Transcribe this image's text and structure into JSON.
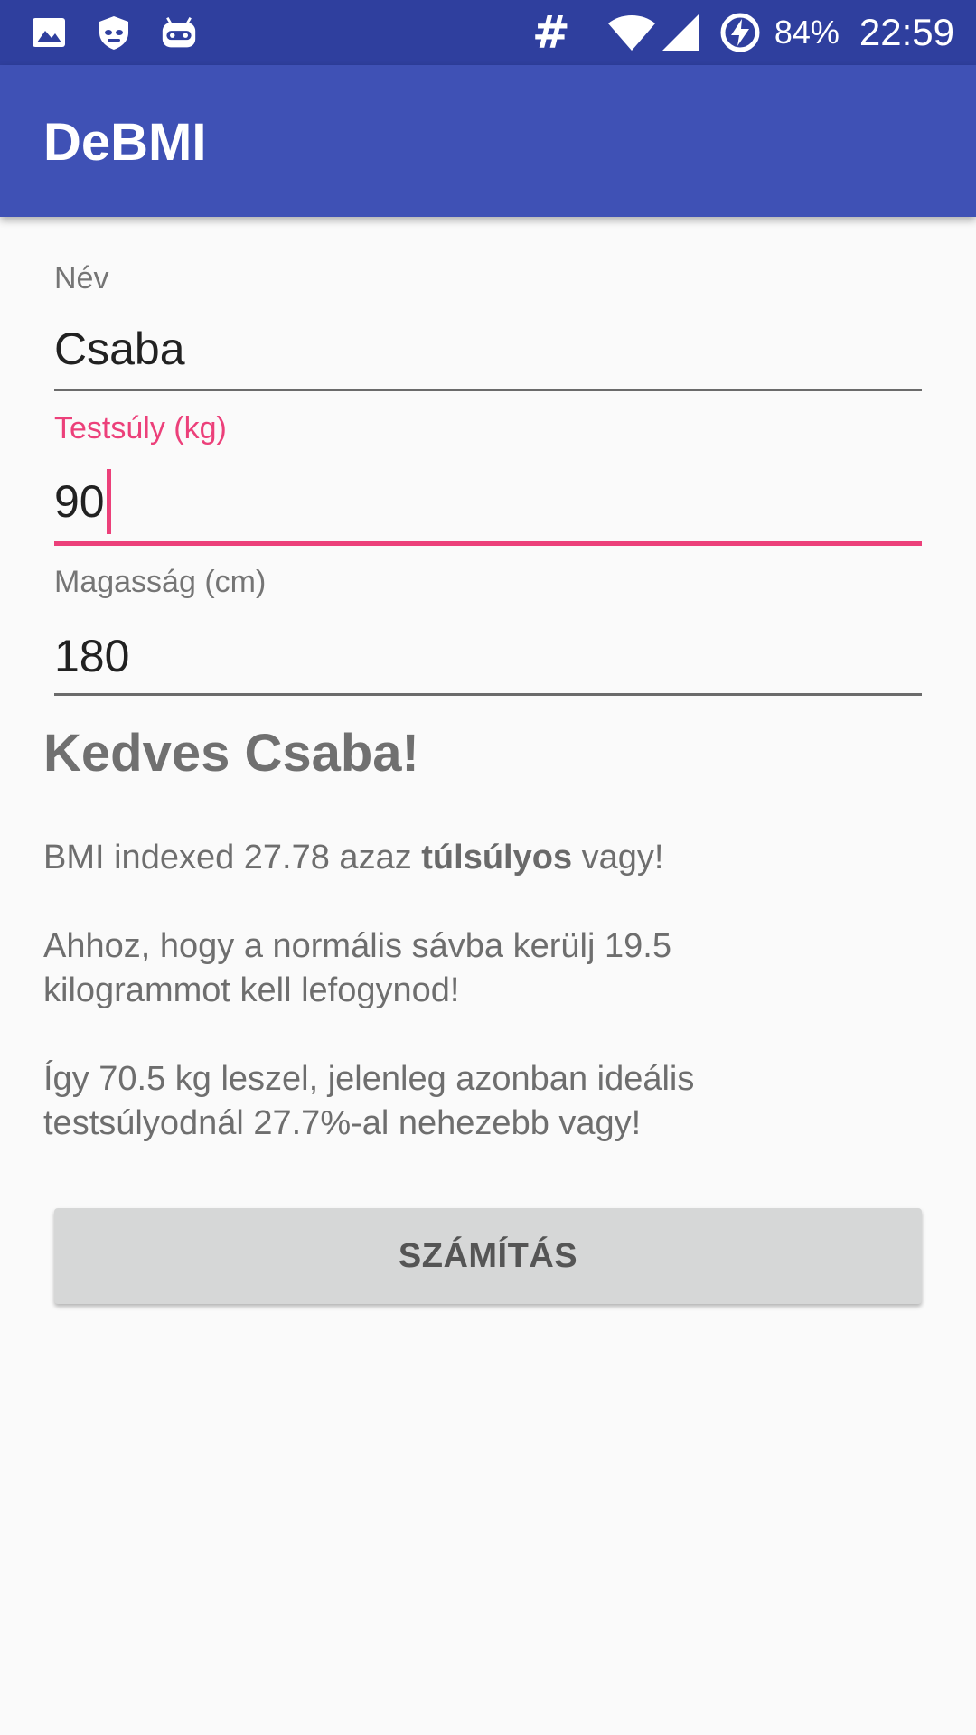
{
  "status_bar": {
    "battery": "84%",
    "time": "22:59",
    "hash_symbol": "#",
    "icons": [
      "image-icon",
      "shield-icon",
      "android-icon",
      "wifi-icon",
      "signal-icon",
      "battery-charging-icon"
    ]
  },
  "app_bar": {
    "title": "DeBMI"
  },
  "form": {
    "name": {
      "label": "Név",
      "value": "Csaba"
    },
    "weight": {
      "label": "Testsúly (kg)",
      "value": "90"
    },
    "height": {
      "label": "Magasság (cm)",
      "value": "180"
    }
  },
  "result": {
    "greeting": "Kedves Csaba!",
    "bmi_prefix": "BMI indexed 27.78 azaz ",
    "bmi_category": "túlsúlyos",
    "bmi_suffix": " vagy!",
    "line2a": "Ahhoz, hogy a normális sávba kerülj 19.5",
    "line2b": "kilogrammot kell lefogynod!",
    "line3a": "Így 70.5 kg leszel, jelenleg azonban ideális",
    "line3b": "testsúlyodnál 27.7%-al nehezebb vagy!"
  },
  "button": {
    "label": "SZÁMÍTÁS"
  },
  "colors": {
    "status_bar": "#2f3f9e",
    "app_bar": "#3f51b5",
    "accent": "#ec407a",
    "button": "#d6d7d7"
  }
}
